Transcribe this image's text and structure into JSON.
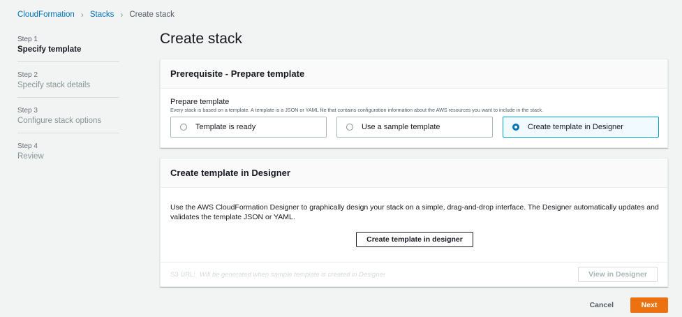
{
  "breadcrumb": {
    "items": [
      "CloudFormation",
      "Stacks"
    ],
    "current": "Create stack"
  },
  "steps": [
    {
      "num": "Step 1",
      "title": "Specify template",
      "active": true
    },
    {
      "num": "Step 2",
      "title": "Specify stack details",
      "active": false
    },
    {
      "num": "Step 3",
      "title": "Configure stack options",
      "active": false
    },
    {
      "num": "Step 4",
      "title": "Review",
      "active": false
    }
  ],
  "page_title": "Create stack",
  "prerequisite": {
    "header": "Prerequisite - Prepare template",
    "label": "Prepare template",
    "description": "Every stack is based on a template. A template is a JSON or YAML file that contains configuration information about the AWS resources you want to include in the stack.",
    "options": [
      {
        "label": "Template is ready",
        "selected": false
      },
      {
        "label": "Use a sample template",
        "selected": false
      },
      {
        "label": "Create template in Designer",
        "selected": true
      }
    ]
  },
  "designer": {
    "header": "Create template in Designer",
    "text": "Use the AWS CloudFormation Designer to graphically design your stack on a simple, drag-and-drop interface. The Designer automatically updates and validates the template JSON or YAML.",
    "button": "Create template in designer",
    "s3_label": "S3 URL:",
    "s3_value": "Will be generated when sample template is created in Designer",
    "view_button": "View in Designer"
  },
  "actions": {
    "cancel": "Cancel",
    "next": "Next"
  },
  "colors": {
    "accent": "#0073bb",
    "primary_button": "#ec7211",
    "selected_tile_border": "#00a1c9"
  }
}
